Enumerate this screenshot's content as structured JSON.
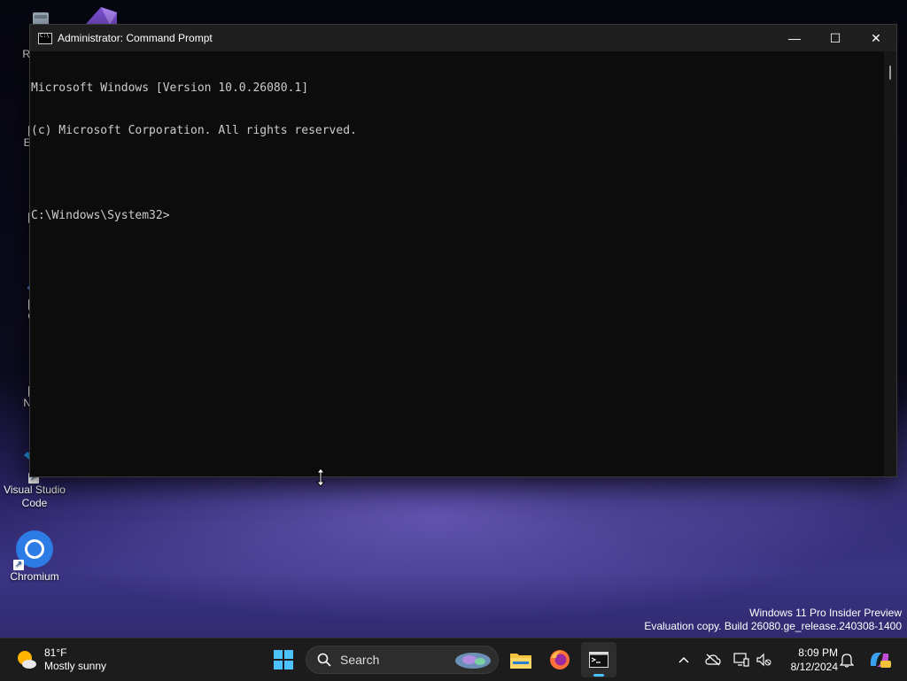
{
  "desktop_icons": [
    {
      "name": "recycle-bin",
      "label": "Recy"
    },
    {
      "name": "everything",
      "label": "Ever"
    },
    {
      "name": "firefox",
      "label": "Fir"
    },
    {
      "name": "git",
      "label": "Git"
    },
    {
      "name": "notepad",
      "label": "Note"
    },
    {
      "name": "vscode",
      "label": "Visual Studio Code"
    },
    {
      "name": "chromium",
      "label": "Chromium"
    }
  ],
  "window": {
    "title": "Administrator: Command Prompt",
    "controls": {
      "minimize": "—",
      "maximize": "☐",
      "close": "✕"
    },
    "console_lines": [
      "Microsoft Windows [Version 10.0.26080.1]",
      "(c) Microsoft Corporation. All rights reserved.",
      "",
      "C:\\Windows\\System32>"
    ]
  },
  "watermark": {
    "line1": "Windows 11 Pro Insider Preview",
    "line2": "Evaluation copy. Build 26080.ge_release.240308-1400"
  },
  "taskbar": {
    "weather": {
      "temp": "81°F",
      "condition": "Mostly sunny"
    },
    "search_placeholder": "Search",
    "apps": [
      "start",
      "file-explorer",
      "firefox",
      "terminal"
    ],
    "clock": {
      "time": "8:09 PM",
      "date": "8/12/2024"
    },
    "tray_icons": [
      "chevron-up-icon",
      "onedrive-offline-icon",
      "display-icon",
      "volume-muted-icon",
      "notification-icon",
      "copilot-icon"
    ]
  },
  "colors": {
    "console_bg": "#0c0c0c",
    "console_text": "#cccccc",
    "taskbar_bg": "#1c1c1c"
  }
}
